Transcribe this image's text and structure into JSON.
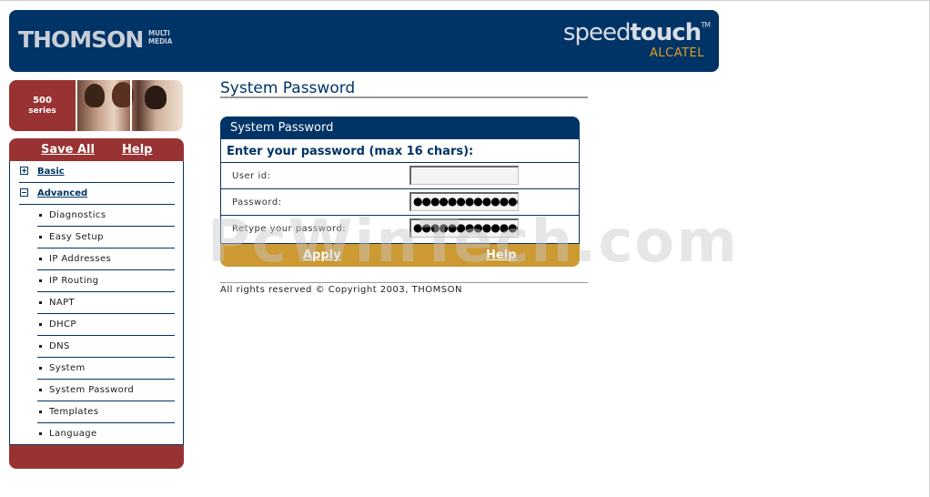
{
  "header": {
    "brand": "THOMSON",
    "brand_sub": "MULTI MEDIA",
    "product_light": "speed",
    "product_bold": "touch",
    "product_tm": "TM",
    "partner": "ALCATEL"
  },
  "sidebar": {
    "series_number": "500",
    "series_word": "series",
    "save_all": "Save All",
    "help": "Help",
    "top_items": [
      {
        "label": "Basic",
        "expanded": false
      },
      {
        "label": "Advanced",
        "expanded": true
      }
    ],
    "sub_items": [
      "Diagnostics",
      "Easy Setup",
      "IP Addresses",
      "IP Routing",
      "NAPT",
      "DHCP",
      "DNS",
      "System",
      "System Password",
      "Templates",
      "Language"
    ]
  },
  "main": {
    "page_title": "System Password",
    "panel_title": "System Password",
    "instruction": "Enter your password (max 16 chars):",
    "fields": {
      "user_label": "User id:",
      "user_value": "",
      "password_label": "Password:",
      "password_value": "●●●●●●●●●●●●●●●",
      "retype_label": "Retype your password:",
      "retype_value": "●●●●●●●●●●●●●●●"
    },
    "apply": "Apply",
    "help": "Help",
    "copyright": "All rights reserved © Copyright 2003, THOMSON"
  },
  "watermark": "PcWinTech.com",
  "colors": {
    "navy": "#003366",
    "maroon": "#993333",
    "gold": "#cc9933"
  }
}
